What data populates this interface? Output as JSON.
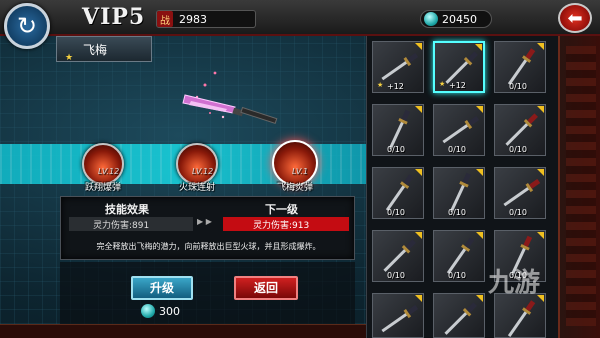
{
  "header": {
    "vip": "VIP5",
    "power_icon": "战",
    "power_value": "2983",
    "currency_value": "20450"
  },
  "weapon": {
    "name": "飞梅"
  },
  "skills": [
    {
      "name": "跃翔爆弹",
      "level": "LV.12"
    },
    {
      "name": "火珠连射",
      "level": "LV.12"
    },
    {
      "name": "飞梅炎弹",
      "level": "LV.1"
    }
  ],
  "info": {
    "current_title": "技能效果",
    "next_title": "下一级",
    "current_value": "灵力伤害:891",
    "arrows": "▶ ▶",
    "next_value": "灵力伤害:913",
    "description": "完全释放出飞梅的潜力，向前释放出巨型火球，并且形成爆炸。"
  },
  "buttons": {
    "upgrade": "升级",
    "back": "返回",
    "cost": "300"
  },
  "inventory": [
    {
      "count": "+12",
      "star": true
    },
    {
      "count": "+12",
      "star": true
    },
    {
      "count": "0/10"
    },
    {
      "count": "0/10"
    },
    {
      "count": "0/10"
    },
    {
      "count": "0/10"
    },
    {
      "count": "0/10"
    },
    {
      "count": "0/10"
    },
    {
      "count": "0/10"
    },
    {
      "count": "0/10"
    },
    {
      "count": "0/10"
    },
    {
      "count": "0/10"
    },
    {
      "count": ""
    },
    {
      "count": ""
    },
    {
      "count": ""
    }
  ],
  "watermark": "九游",
  "colors": {
    "accent_cyan": "#19d8e4",
    "red_button": "#c40c12",
    "blue_button": "#2a8ab0"
  }
}
